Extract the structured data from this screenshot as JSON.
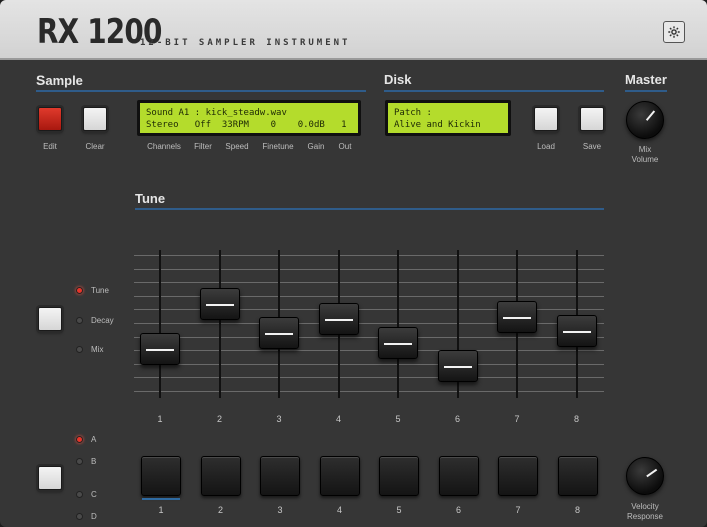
{
  "header": {
    "brand": "RX 1200",
    "tagline": "12-BIT SAMPLER INSTRUMENT"
  },
  "sample": {
    "title_first": "S",
    "title_rest": "ample",
    "edit_label": "Edit",
    "clear_label": "Clear",
    "lcd_line1": "Sound A1 : kick_steadw.wav",
    "lcd_line2": "Stereo   Off  33RPM    0    0.0dB   1",
    "params": [
      "Channels",
      "Filter",
      "Speed",
      "Finetune",
      "Gain",
      "Out"
    ]
  },
  "disk": {
    "title": "Disk",
    "lcd_line1": "Patch :",
    "lcd_line2": "Alive and Kickin",
    "load_label": "Load",
    "save_label": "Save"
  },
  "master": {
    "title": "Master",
    "mix_label_1": "Mix",
    "mix_label_2": "Volume",
    "velocity_label_1": "Velocity",
    "velocity_label_2": "Response"
  },
  "tune": {
    "title": "Tune",
    "modes": [
      {
        "label": "Tune",
        "active": true
      },
      {
        "label": "Decay",
        "active": false
      },
      {
        "label": "Mix",
        "active": false
      }
    ],
    "slider_labels": [
      "1",
      "2",
      "3",
      "4",
      "5",
      "6",
      "7",
      "8"
    ],
    "slider_values": [
      0.33,
      0.73,
      0.47,
      0.6,
      0.38,
      0.18,
      0.62,
      0.49
    ]
  },
  "banks": {
    "options": [
      {
        "label": "A",
        "active": true
      },
      {
        "label": "B",
        "active": false
      },
      {
        "label": "C",
        "active": false
      },
      {
        "label": "D",
        "active": false
      }
    ]
  },
  "pads": {
    "labels": [
      "1",
      "2",
      "3",
      "4",
      "5",
      "6",
      "7",
      "8"
    ],
    "active_pad": "1"
  },
  "colors": {
    "lcd": "#b4dc2c",
    "accent_line": "#2f5c8a",
    "led_on": "#e8352a"
  }
}
